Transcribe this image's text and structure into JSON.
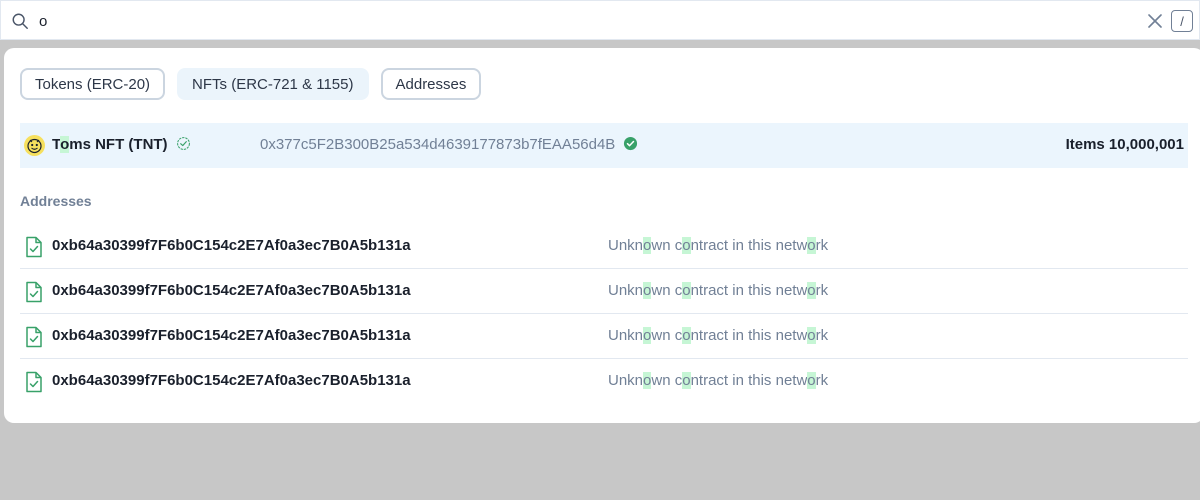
{
  "search": {
    "value": "o",
    "slash_hint": "/"
  },
  "tabs": [
    {
      "label": "Tokens (ERC-20)",
      "active": false
    },
    {
      "label": "NFTs (ERC-721 & 1155)",
      "active": true
    },
    {
      "label": "Addresses",
      "active": false
    }
  ],
  "token_result": {
    "name_prefix": "T",
    "name_match": "o",
    "name_suffix": "ms NFT (TNT)",
    "address": "0x377c5F2B300B25a534d4639177873b7fEAA56d4B",
    "items_label": "Items 10,000,001"
  },
  "addresses_section": {
    "title": "Addresses",
    "desc_parts": [
      "Unkn",
      "o",
      "wn c",
      "o",
      "ntract in this netw",
      "o",
      "rk"
    ],
    "items": [
      {
        "hash": "0xb64a30399f7F6b0C154c2E7Af0a3ec7B0A5b131a"
      },
      {
        "hash": "0xb64a30399f7F6b0C154c2E7Af0a3ec7B0A5b131a"
      },
      {
        "hash": "0xb64a30399f7F6b0C154c2E7Af0a3ec7B0A5b131a"
      },
      {
        "hash": "0xb64a30399f7F6b0C154c2E7Af0a3ec7B0A5b131a"
      }
    ]
  },
  "colors": {
    "highlight": "#c6f6d5",
    "verified_green": "#38a169",
    "contract_icon_green": "#38a169",
    "selected_row_bg": "#ebf5fd"
  },
  "icons": {
    "search": "search-icon",
    "clear": "close-icon",
    "token_logo": "token-logo-icon",
    "verified_outline": "verified-outline-icon",
    "verified_filled": "verified-check-icon",
    "contract": "contract-file-icon"
  }
}
